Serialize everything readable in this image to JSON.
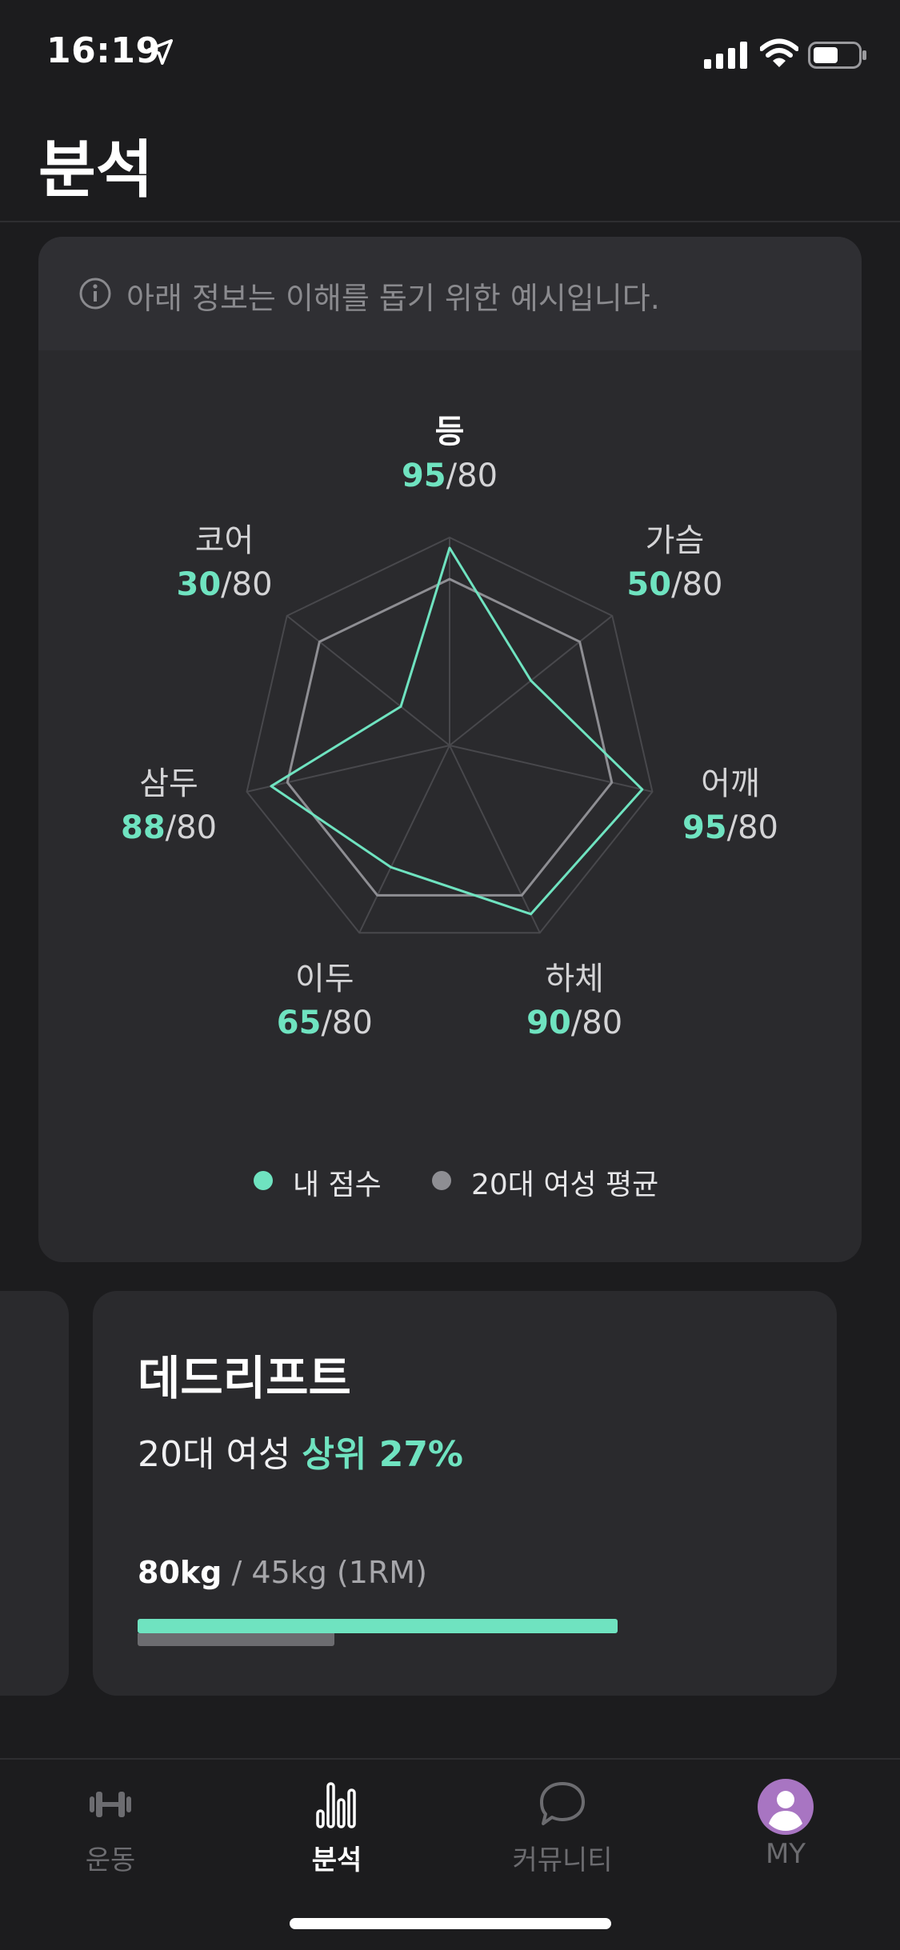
{
  "status_bar": {
    "time": "16:19"
  },
  "header": {
    "title": "분석"
  },
  "notice": {
    "text": "아래 정보는 이해를 돕기 위한 예시입니다."
  },
  "colors": {
    "accent": "#6fe3c0",
    "average": "#8e8e93",
    "background": "#1c1c1e",
    "card": "#2a2a2d"
  },
  "chart_data": {
    "type": "radar",
    "axes": [
      {
        "name": "등",
        "mine": 95,
        "max": 80
      },
      {
        "name": "가슴",
        "mine": 50,
        "max": 80
      },
      {
        "name": "어깨",
        "mine": 95,
        "max": 80
      },
      {
        "name": "하체",
        "mine": 90,
        "max": 80
      },
      {
        "name": "이두",
        "mine": 65,
        "max": 80
      },
      {
        "name": "삼두",
        "mine": 88,
        "max": 80
      },
      {
        "name": "코어",
        "mine": 30,
        "max": 80
      }
    ],
    "series": [
      {
        "name": "내 점수",
        "values": [
          95,
          50,
          95,
          90,
          65,
          88,
          30
        ]
      },
      {
        "name": "20대 여성 평균",
        "values": [
          80,
          80,
          80,
          80,
          80,
          80,
          80
        ]
      }
    ],
    "rlim": [
      0,
      100
    ],
    "legend": "bottom-center"
  },
  "score_sep": "/",
  "legend": {
    "mine": "내 점수",
    "average": "20대 여성 평균"
  },
  "exercise": {
    "name": "데드리프트",
    "rank_prefix": "20대 여성",
    "rank_value": "상위 27%",
    "my_weight": "80kg",
    "weight_detail": "/ 45kg (1RM)",
    "my_value_kg": 80,
    "avg_value_kg": 45
  },
  "tabs": [
    {
      "label": "운동",
      "icon": "dumbbell-icon"
    },
    {
      "label": "분석",
      "icon": "bar-chart-icon"
    },
    {
      "label": "커뮤니티",
      "icon": "chat-bubble-icon"
    },
    {
      "label": "MY",
      "icon": "avatar-icon"
    }
  ]
}
